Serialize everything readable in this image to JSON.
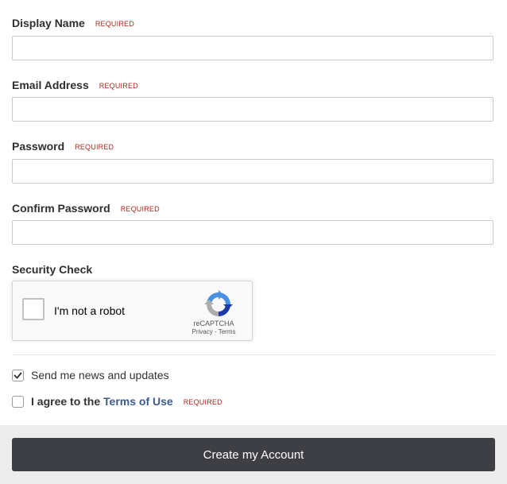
{
  "fields": [
    {
      "label": "Display Name",
      "required": "REQUIRED",
      "value": ""
    },
    {
      "label": "Email Address",
      "required": "REQUIRED",
      "value": ""
    },
    {
      "label": "Password",
      "required": "REQUIRED",
      "value": ""
    },
    {
      "label": "Confirm Password",
      "required": "REQUIRED",
      "value": ""
    }
  ],
  "security": {
    "label": "Security Check",
    "captcha_text": "I'm not a robot",
    "captcha_brand": "reCAPTCHA",
    "captcha_links": "Privacy - Terms"
  },
  "checkboxes": {
    "news": {
      "label": "Send me news and updates",
      "checked": true
    },
    "terms": {
      "prefix": "I agree to the",
      "link": "Terms of Use",
      "required": "REQUIRED",
      "checked": false
    }
  },
  "submit_label": "Create my Account",
  "colors": {
    "required": "#b3261e",
    "button": "#3d3f44",
    "link": "#3c5a8a",
    "footer": "#ececec"
  }
}
